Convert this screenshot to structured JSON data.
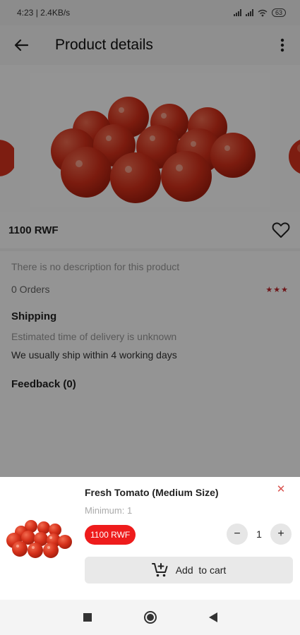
{
  "status_bar": {
    "time_speed": "4:23 | 2.4KB/s",
    "battery": "63"
  },
  "app_bar": {
    "title": "Product details",
    "back_icon": "arrow-left-icon",
    "more_icon": "more-vertical-icon"
  },
  "product": {
    "price": "1100 RWF",
    "description": "There is no description for this product",
    "orders": "0 Orders",
    "rating_stars": "★★★"
  },
  "shipping": {
    "title": "Shipping",
    "estimate": "Estimated time of delivery is unknown",
    "usual": "We usually ship within 4 working days"
  },
  "feedback": {
    "title": "Feedback (0)"
  },
  "sheet": {
    "name": "Fresh Tomato (Medium Size)",
    "minimum": "Minimum: 1",
    "price_badge": "1100 RWF",
    "quantity": "1",
    "minus": "−",
    "plus": "+",
    "close": "✕",
    "add_to_cart": "Add  to cart"
  },
  "colors": {
    "accent_red": "#ee1c1c",
    "star_red": "#c0262b"
  }
}
